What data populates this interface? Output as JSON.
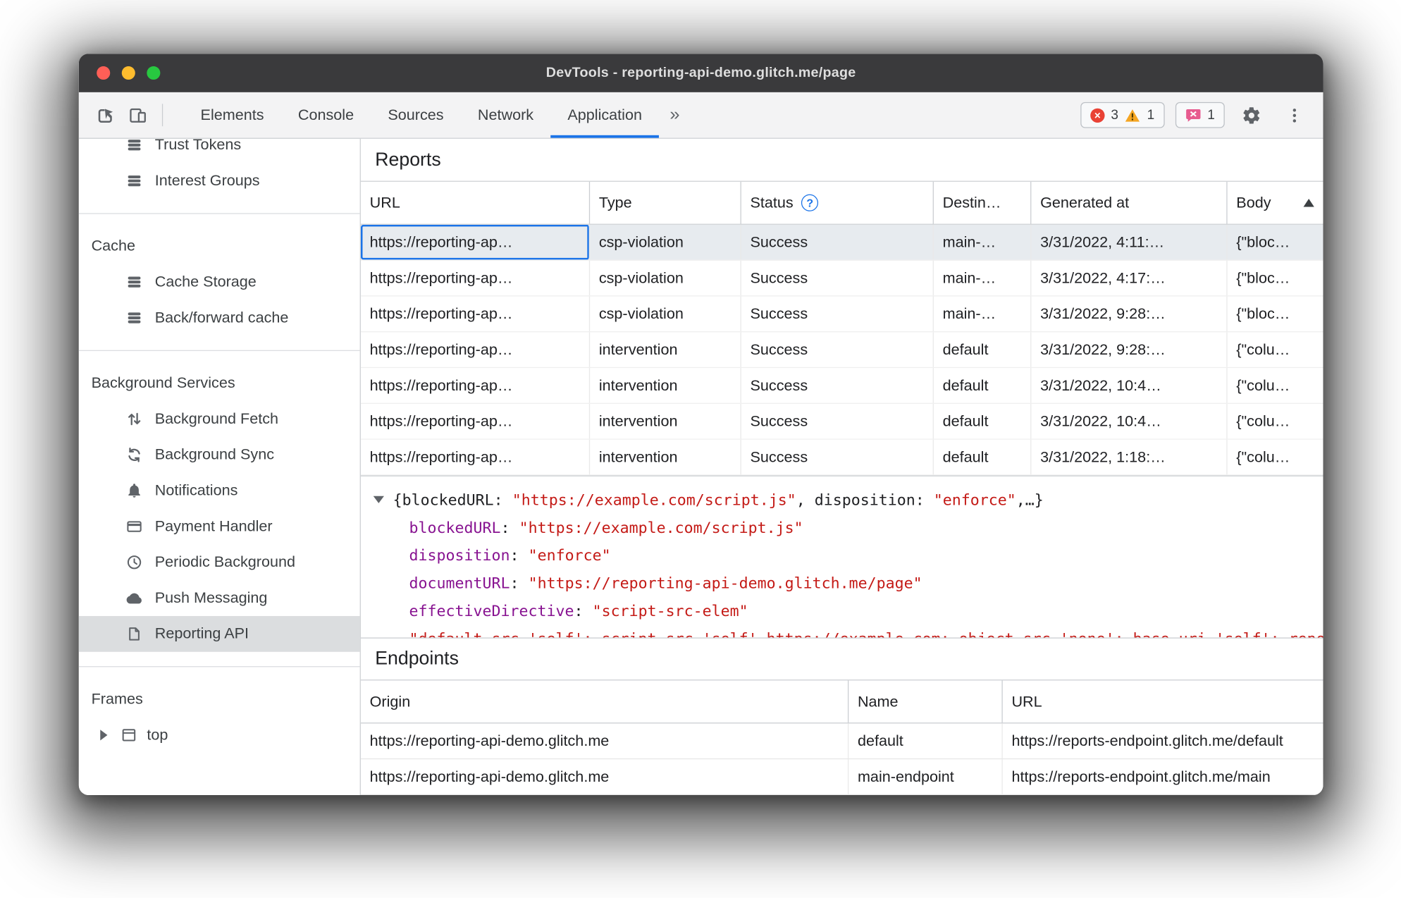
{
  "window": {
    "title": "DevTools - reporting-api-demo.glitch.me/page"
  },
  "toolbar": {
    "tabs": {
      "elements": "Elements",
      "console": "Console",
      "sources": "Sources",
      "network": "Network",
      "application": "Application"
    },
    "selected_tab": "Application",
    "more_panels": "»",
    "error_count": "3",
    "warning_count": "1",
    "issue_count": "1"
  },
  "sidebar": {
    "trust_tokens": "Trust Tokens",
    "interest_groups": "Interest Groups",
    "cache_header": "Cache",
    "cache_storage": "Cache Storage",
    "back_forward_cache": "Back/forward cache",
    "background_services_header": "Background Services",
    "background_fetch": "Background Fetch",
    "background_sync": "Background Sync",
    "notifications": "Notifications",
    "payment_handler": "Payment Handler",
    "periodic_background_sync": "Periodic Background",
    "push_messaging": "Push Messaging",
    "reporting_api": "Reporting API",
    "frames_header": "Frames",
    "top_frame": "top"
  },
  "reports": {
    "title": "Reports",
    "columns": {
      "url": "URL",
      "type": "Type",
      "status": "Status",
      "status_help": "?",
      "destination": "Destin…",
      "generated_at": "Generated at",
      "body": "Body"
    },
    "body_sort": "ascending",
    "rows": [
      {
        "url": "https://reporting-ap…",
        "type": "csp-violation",
        "status": "Success",
        "destination": "main-…",
        "generated_at": "3/31/2022, 4:11:…",
        "body": "{\"bloc…"
      },
      {
        "url": "https://reporting-ap…",
        "type": "csp-violation",
        "status": "Success",
        "destination": "main-…",
        "generated_at": "3/31/2022, 4:17:…",
        "body": "{\"bloc…"
      },
      {
        "url": "https://reporting-ap…",
        "type": "csp-violation",
        "status": "Success",
        "destination": "main-…",
        "generated_at": "3/31/2022, 9:28:…",
        "body": "{\"bloc…"
      },
      {
        "url": "https://reporting-ap…",
        "type": "intervention",
        "status": "Success",
        "destination": "default",
        "generated_at": "3/31/2022, 9:28:…",
        "body": "{\"colu…"
      },
      {
        "url": "https://reporting-ap…",
        "type": "intervention",
        "status": "Success",
        "destination": "default",
        "generated_at": "3/31/2022, 10:4…",
        "body": "{\"colu…"
      },
      {
        "url": "https://reporting-ap…",
        "type": "intervention",
        "status": "Success",
        "destination": "default",
        "generated_at": "3/31/2022, 10:4…",
        "body": "{\"colu…"
      },
      {
        "url": "https://reporting-ap…",
        "type": "intervention",
        "status": "Success",
        "destination": "default",
        "generated_at": "3/31/2022, 1:18:…",
        "body": "{\"colu…"
      }
    ]
  },
  "preview": {
    "collapsed": {
      "seg0": "{blockedURL: ",
      "seg1": "\"https://example.com/script.js\"",
      "seg2": ", disposition: ",
      "seg3": "\"enforce\"",
      "seg4": ",…}"
    },
    "separator": ": ",
    "props": [
      {
        "key": "blockedURL",
        "value": "\"https://example.com/script.js\""
      },
      {
        "key": "disposition",
        "value": "\"enforce\""
      },
      {
        "key": "documentURL",
        "value": "\"https://reporting-api-demo.glitch.me/page\""
      },
      {
        "key": "effectiveDirective",
        "value": "\"script-src-elem\""
      }
    ],
    "clipped_line": "\"default-src 'self'; script-src 'self' https://example.com; object-src 'none'; base-uri 'self'; report-to main-endpoint\""
  },
  "endpoints": {
    "title": "Endpoints",
    "columns": {
      "origin": "Origin",
      "name": "Name",
      "url": "URL"
    },
    "rows": [
      {
        "origin": "https://reporting-api-demo.glitch.me",
        "name": "default",
        "url": "https://reports-endpoint.glitch.me/default"
      },
      {
        "origin": "https://reporting-api-demo.glitch.me",
        "name": "main-endpoint",
        "url": "https://reports-endpoint.glitch.me/main"
      }
    ]
  },
  "colors": {
    "accent": "#1A73E8",
    "error_badge": "#E94235",
    "warning_badge": "#F5A623",
    "issue_badge": "#E75B8F",
    "json_key": "#881391",
    "json_string": "#C41A16",
    "titlebar": "#3A3A3C",
    "selected_row": "#E7EBEF"
  }
}
